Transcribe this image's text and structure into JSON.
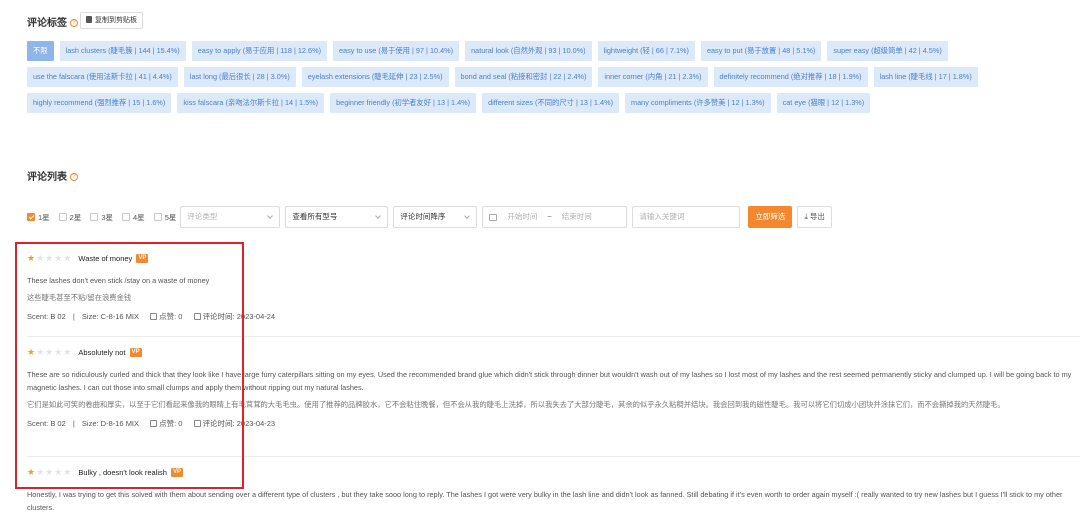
{
  "tags_section": {
    "title": "评论标签",
    "help": "?",
    "copy_button": "复制到剪贴板",
    "tags": [
      {
        "label": "不限",
        "active": true
      },
      {
        "label": "lash clusters (睫毛簇 | 144 | 15.4%)"
      },
      {
        "label": "easy to apply (易于应用 | 118 | 12.6%)"
      },
      {
        "label": "easy to use (易于使用 | 97 | 10.4%)"
      },
      {
        "label": "natural look (自然外观 | 93 | 10.0%)"
      },
      {
        "label": "lightweight (轻 | 66 | 7.1%)"
      },
      {
        "label": "easy to put (易于放置 | 48 | 5.1%)"
      },
      {
        "label": "super easy (超级简单 | 42 | 4.5%)"
      },
      {
        "label": "use the falscara (使用法斯卡拉 | 41 | 4.4%)"
      },
      {
        "label": "last long (最后很长 | 28 | 3.0%)"
      },
      {
        "label": "eyelash extensions (睫毛延伸 | 23 | 2.5%)"
      },
      {
        "label": "bond and seal (粘接和密封 | 22 | 2.4%)"
      },
      {
        "label": "inner corner (内角 | 21 | 2.3%)"
      },
      {
        "label": "definitely recommend (绝对推荐 | 18 | 1.9%)"
      },
      {
        "label": "lash line (睫毛线 | 17 | 1.8%)"
      },
      {
        "label": "highly recommend (强烈推荐 | 15 | 1.6%)"
      },
      {
        "label": "kiss falscara (亲吻法尔斯卡拉 | 14 | 1.5%)"
      },
      {
        "label": "beginner friendly (初学者友好 | 13 | 1.4%)"
      },
      {
        "label": "different sizes (不同的尺寸 | 13 | 1.4%)"
      },
      {
        "label": "many compliments (许多赞美 | 12 | 1.3%)"
      },
      {
        "label": "cat eye (猫眼 | 12 | 1.3%)"
      }
    ]
  },
  "list_section": {
    "title": "评论列表",
    "help": "?"
  },
  "filters": {
    "ratings": [
      {
        "label": "1星",
        "checked": true
      },
      {
        "label": "2星",
        "checked": false
      },
      {
        "label": "3星",
        "checked": false
      },
      {
        "label": "4星",
        "checked": false
      },
      {
        "label": "5星",
        "checked": false
      }
    ],
    "review_type_placeholder": "评论类型",
    "model_select": "查看所有型号",
    "sort_select": "评论时间降序",
    "start_date_placeholder": "开始时间",
    "date_separator": "~",
    "end_date_placeholder": "结束时间",
    "keyword_placeholder": "请输入关键词",
    "filter_button": "立即筛选",
    "export_button": "导出"
  },
  "reviews": [
    {
      "rating": 1,
      "title": "Waste of money",
      "badge": "VP",
      "text": "These lashes don't even stick /stay on a waste of money",
      "translation": "这些睫毛甚至不粘/留在浪费金钱",
      "scent": "Scent: B 02",
      "sep": "|",
      "size": "Size: C-8-16 MIX",
      "likes": "点赞: 0",
      "time": "评论时间: 2023-04-24"
    },
    {
      "rating": 1,
      "title": "Absolutely not",
      "badge": "VP",
      "text": "These are so ridiculously curled and thick that they look like I have large furry caterpillars sitting on my eyes. Used the recommended brand glue which didn't stick through dinner but wouldn't wash out of my lashes so I lost most of my lashes and the rest seemed permanently sticky and clumped up. I will be going back to my magnetic lashes. I can cut those into small clumps and apply them without ripping out my natural lashes.",
      "translation": "它们是如此可笑的卷曲和厚实，以至于它们看起来像我的眼睛上有毛茸茸的大毛毛虫。使用了推荐的品牌胶水，它不会粘住晚餐，但不会从我的睫毛上洗掉，所以我失去了大部分睫毛，其余的似乎永久粘稠并结块。我会回到我的磁性睫毛。我可以将它们切成小团块并涂抹它们，而不会撕掉我的天然睫毛。",
      "scent": "Scent: B 02",
      "sep": "|",
      "size": "Size: D-8-16 MIX",
      "likes": "点赞: 0",
      "time": "评论时间: 2023-04-23"
    },
    {
      "rating": 1,
      "title": "Bulky , doesn't look realish",
      "badge": "VP",
      "text": "Honestly, I was trying to get this solved with them about sending over a different type of clusters , but they take sooo long to reply. The lashes I got were very bulky in the lash line and didn't look as fanned. Still debating if it's even worth to order again myself :( really wanted to try new lashes but I guess I'll stick to my other clusters."
    }
  ]
}
